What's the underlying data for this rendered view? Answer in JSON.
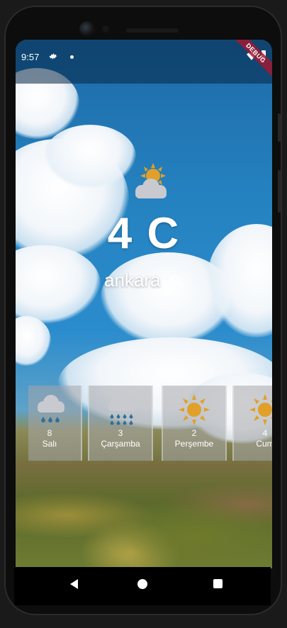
{
  "status_bar": {
    "time": "9:57",
    "debug_label": "DEBUG"
  },
  "weather": {
    "icon": "partly-cloudy-icon",
    "temperature": "4 C",
    "city": "ankara"
  },
  "forecast": [
    {
      "icon": "rain-icon",
      "temperature": "8",
      "day": "Salı"
    },
    {
      "icon": "heavy-rain-icon",
      "temperature": "3",
      "day": "Çarşamba"
    },
    {
      "icon": "sun-icon",
      "temperature": "2",
      "day": "Perşembe"
    },
    {
      "icon": "sun-icon",
      "temperature": "4",
      "day": "Cum"
    }
  ],
  "colors": {
    "sun": "#e0a02a",
    "cloud": "#c8cacf",
    "rain": "#2f6f98"
  }
}
